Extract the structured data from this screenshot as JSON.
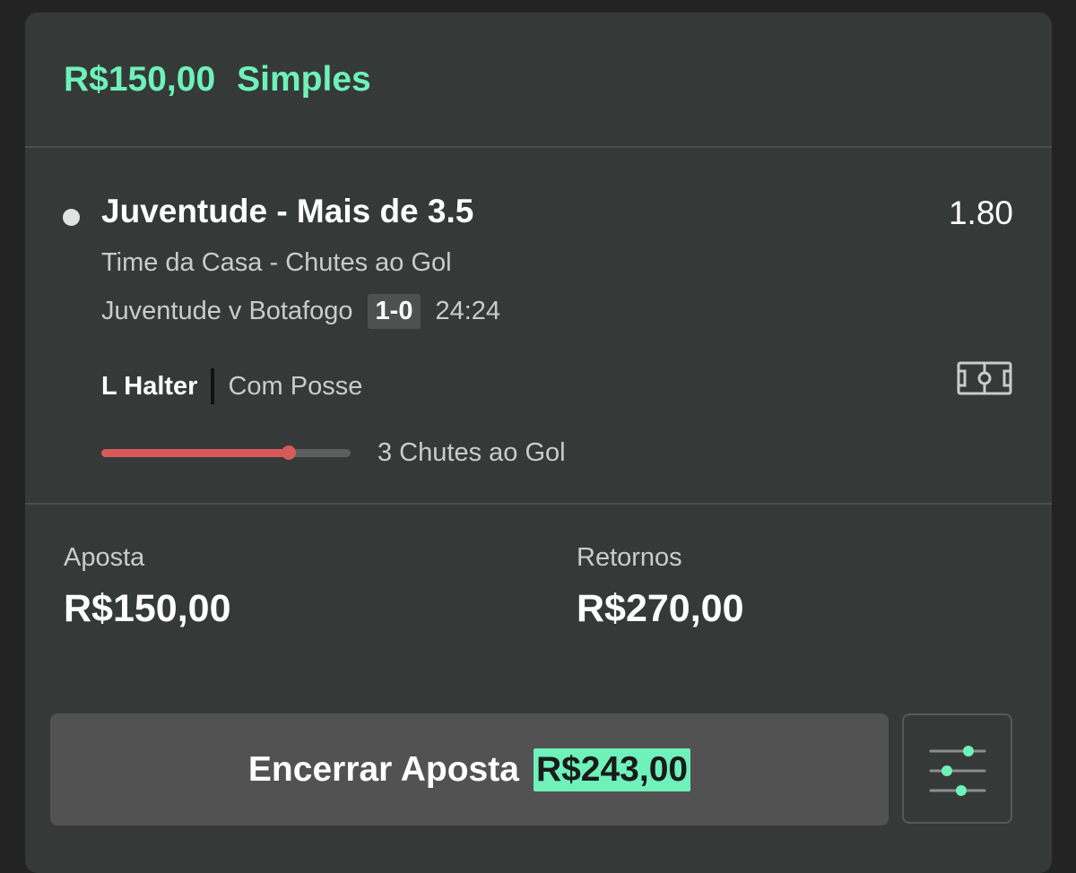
{
  "header": {
    "amount": "R$150,00",
    "bet_type": "Simples"
  },
  "selection": {
    "title": "Juventude - Mais de 3.5",
    "odds": "1.80",
    "market": "Time da Casa - Chutes ao Gol",
    "event": "Juventude v Botafogo",
    "score": "1-0",
    "clock": "24:24",
    "player": {
      "name": "L Halter",
      "status": "Com Posse"
    },
    "progress": {
      "fraction": 0.75,
      "label": "3 Chutes ao Gol"
    },
    "pitch_icon": "pitch-icon"
  },
  "summary": {
    "stake_label": "Aposta",
    "stake_value": "R$150,00",
    "returns_label": "Retornos",
    "returns_value": "R$270,00"
  },
  "actions": {
    "cashout_label": "Encerrar Aposta",
    "cashout_amount": "R$243,00",
    "settings_icon": "sliders-icon"
  },
  "colors": {
    "accent": "#6ef2ba",
    "progress": "#d75a5b",
    "card_bg": "#353a38",
    "page_bg": "#232323"
  }
}
